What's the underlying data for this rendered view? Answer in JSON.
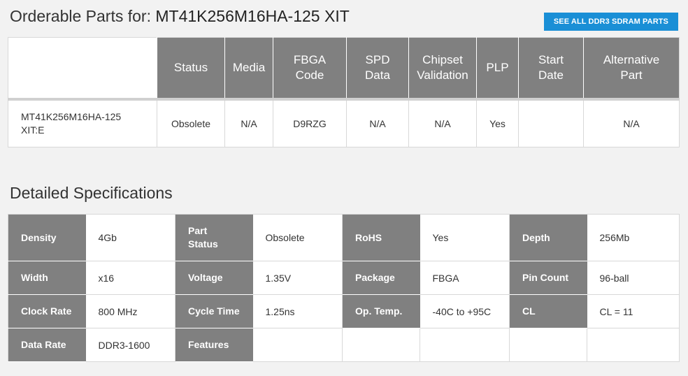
{
  "header": {
    "title_prefix": "Orderable Parts for:",
    "part_number": "MT41K256M16HA-125 XIT",
    "see_all_label": "SEE ALL DDR3 SDRAM PARTS"
  },
  "parts_table": {
    "headers": {
      "status": "Status",
      "media": "Media",
      "fbga_1": "FBGA",
      "fbga_2": "Code",
      "spd_1": "SPD",
      "spd_2": "Data",
      "chipset_1": "Chipset",
      "chipset_2": "Validation",
      "plp": "PLP",
      "start_1": "Start",
      "start_2": "Date",
      "alt_1": "Alternative",
      "alt_2": "Part"
    },
    "row": {
      "part_1": "MT41K256M16HA-125",
      "part_2": "XIT:E",
      "status": "Obsolete",
      "media": "N/A",
      "fbga_code": "D9RZG",
      "spd_data": "N/A",
      "chipset_validation": "N/A",
      "plp": "Yes",
      "start_date": "",
      "alternative_part": "N/A"
    }
  },
  "specs": {
    "title": "Detailed Specifications",
    "density_label": "Density",
    "density_value": "4Gb",
    "part_status_label_1": "Part",
    "part_status_label_2": "Status",
    "part_status_value": "Obsolete",
    "rohs_label": "RoHS",
    "rohs_value": "Yes",
    "depth_label": "Depth",
    "depth_value": "256Mb",
    "width_label": "Width",
    "width_value": "x16",
    "voltage_label": "Voltage",
    "voltage_value": "1.35V",
    "package_label": "Package",
    "package_value": "FBGA",
    "pin_count_label": "Pin Count",
    "pin_count_value": "96-ball",
    "clock_rate_label": "Clock Rate",
    "clock_rate_value": "800 MHz",
    "cycle_time_label": "Cycle Time",
    "cycle_time_value": "1.25ns",
    "op_temp_label": "Op. Temp.",
    "op_temp_value": "-40C to +95C",
    "cl_label": "CL",
    "cl_value": "CL = 11",
    "data_rate_label": "Data Rate",
    "data_rate_value": "DDR3-1600",
    "features_label": "Features",
    "features_value": ""
  },
  "colors": {
    "background": "#f2f2f2",
    "header_gray": "#808080",
    "accent_blue": "#1a8fd6"
  }
}
